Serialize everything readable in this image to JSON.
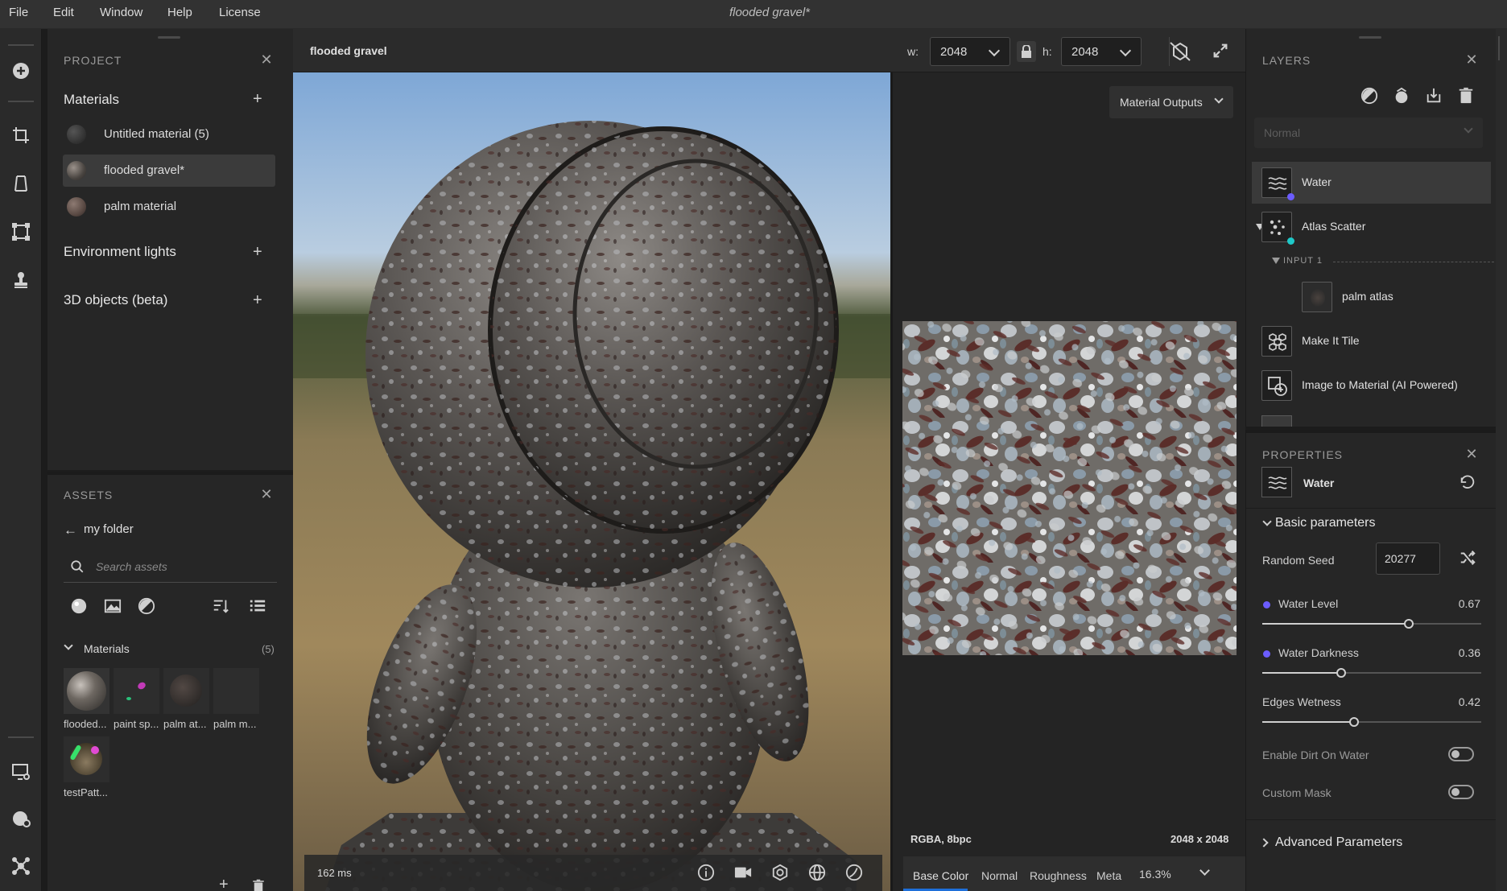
{
  "menu": {
    "items": [
      "File",
      "Edit",
      "Window",
      "Help",
      "License"
    ],
    "document_title": "flooded gravel*"
  },
  "project": {
    "title": "PROJECT",
    "materials_heading": "Materials",
    "materials": [
      {
        "label": "Untitled material (5)"
      },
      {
        "label": "flooded gravel*"
      },
      {
        "label": "palm material"
      }
    ],
    "environment_heading": "Environment lights",
    "objects_heading": "3D objects (beta)"
  },
  "assets": {
    "title": "ASSETS",
    "folder": "my folder",
    "search_placeholder": "Search assets",
    "section": "Materials",
    "count": "(5)",
    "items": [
      {
        "label": "flooded..."
      },
      {
        "label": "paint sp..."
      },
      {
        "label": "palm at..."
      },
      {
        "label": "palm m..."
      },
      {
        "label": "testPatt..."
      }
    ]
  },
  "viewport": {
    "tab_title": "flooded gravel",
    "w_label": "w:",
    "w_value": "2048",
    "h_label": "h:",
    "h_value": "2048",
    "render_time": "162 ms",
    "outputs_label": "Material Outputs",
    "format": "RGBA, 8bpc",
    "resolution": "2048 x 2048",
    "channels": [
      "Base Color",
      "Normal",
      "Roughness",
      "Meta"
    ],
    "zoom": "16.3%"
  },
  "layers": {
    "title": "LAYERS",
    "blend_mode": "Normal",
    "items": [
      {
        "label": "Water"
      },
      {
        "label": "Atlas Scatter"
      },
      {
        "label": "INPUT 1"
      },
      {
        "label": "palm atlas"
      },
      {
        "label": "Make It Tile"
      },
      {
        "label": "Image to Material (AI Powered)"
      }
    ]
  },
  "properties": {
    "title": "PROPERTIES",
    "layer_name": "Water",
    "basic_heading": "Basic parameters",
    "random_seed_label": "Random Seed",
    "random_seed_value": "20277",
    "params": [
      {
        "label": "Water Level",
        "value": "0.67",
        "fraction": 0.67
      },
      {
        "label": "Water Darkness",
        "value": "0.36",
        "fraction": 0.36
      },
      {
        "label": "Edges Wetness",
        "value": "0.42",
        "fraction": 0.42
      }
    ],
    "enable_dirt_label": "Enable Dirt On Water",
    "custom_mask_label": "Custom Mask",
    "advanced_heading": "Advanced Parameters"
  },
  "colors": {
    "accent_blue": "#1e6fd9",
    "dot_purple": "#6b5cff",
    "dot_teal": "#1ec8c8"
  }
}
